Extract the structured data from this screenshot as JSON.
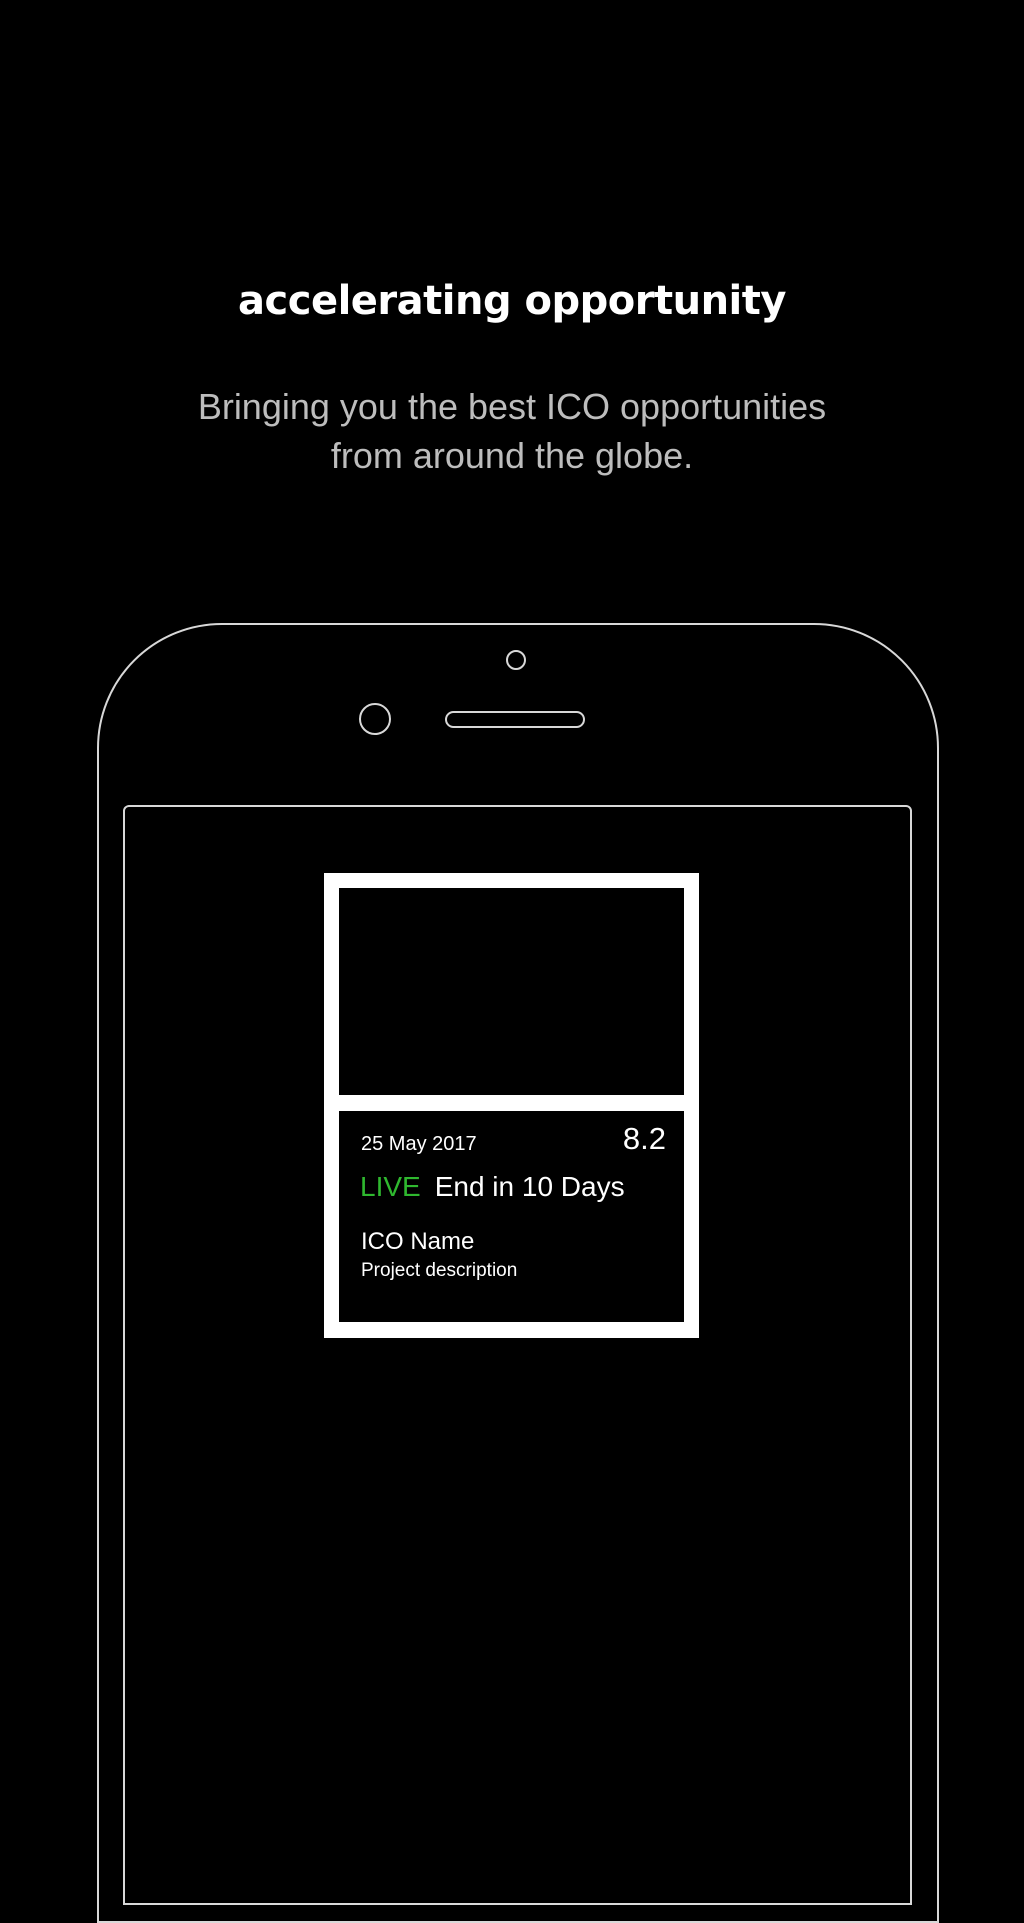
{
  "headline": "accelerating opportunity",
  "subtitle": {
    "line1": "Bringing you the best ICO opportunities",
    "line2": "from around the globe."
  },
  "card": {
    "date": "25 May 2017",
    "score": "8.2",
    "status": "LIVE",
    "ends": "End in 10 Days",
    "name": "ICO Name",
    "description": "Project description"
  },
  "colors": {
    "background": "#000000",
    "outline": "#d8d8d8",
    "live": "#2fb82f",
    "subtitle": "#bdbdbd"
  }
}
